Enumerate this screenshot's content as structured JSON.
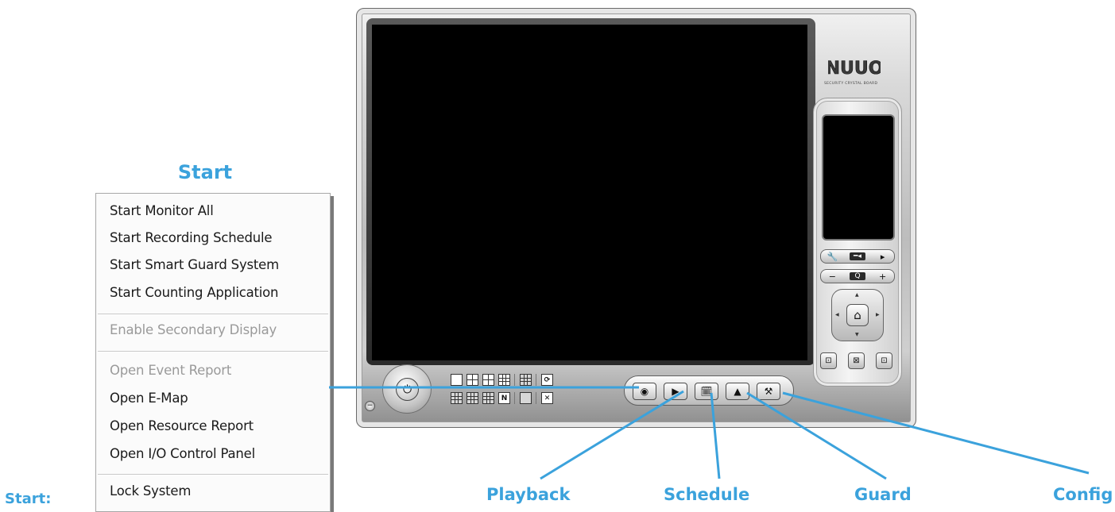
{
  "callouts": {
    "start": "Start",
    "start_caption": "Start:",
    "playback": "Playback",
    "schedule": "Schedule",
    "guard": "Guard",
    "config": "Config"
  },
  "start_menu": {
    "items": [
      {
        "label": "Start Monitor All",
        "enabled": true
      },
      {
        "label": "Start Recording Schedule",
        "enabled": true
      },
      {
        "label": "Start Smart Guard System",
        "enabled": true
      },
      {
        "label": "Start Counting Application",
        "enabled": true
      },
      {
        "label": "Enable Secondary Display",
        "enabled": false
      },
      {
        "label": "Open Event Report",
        "enabled": false
      },
      {
        "label": "Open E-Map",
        "enabled": true
      },
      {
        "label": "Open Resource Report",
        "enabled": true
      },
      {
        "label": "Open I/O Control Panel",
        "enabled": true
      },
      {
        "label": "Lock System",
        "enabled": true
      }
    ]
  },
  "app": {
    "logo_text": "NUUO",
    "logo_subtitle": "SECURITY CRYSTAL BOARD",
    "func_buttons": [
      {
        "name": "start",
        "icon": "record-icon"
      },
      {
        "name": "playback",
        "icon": "playback-icon"
      },
      {
        "name": "schedule",
        "icon": "schedule-icon"
      },
      {
        "name": "guard",
        "icon": "warning-icon"
      },
      {
        "name": "config",
        "icon": "wrench-icon"
      }
    ],
    "layout_buttons_row1": [
      "1x1",
      "2x2",
      "1+5",
      "3x3"
    ],
    "layout_buttons_row2": [
      "4x4",
      "5x5",
      "6x6",
      "N"
    ],
    "ptz": {
      "zoom_label": "Q",
      "home_icon": "home-icon"
    }
  },
  "colors": {
    "callout": "#3ba2dc",
    "video_bg": "#000000"
  }
}
